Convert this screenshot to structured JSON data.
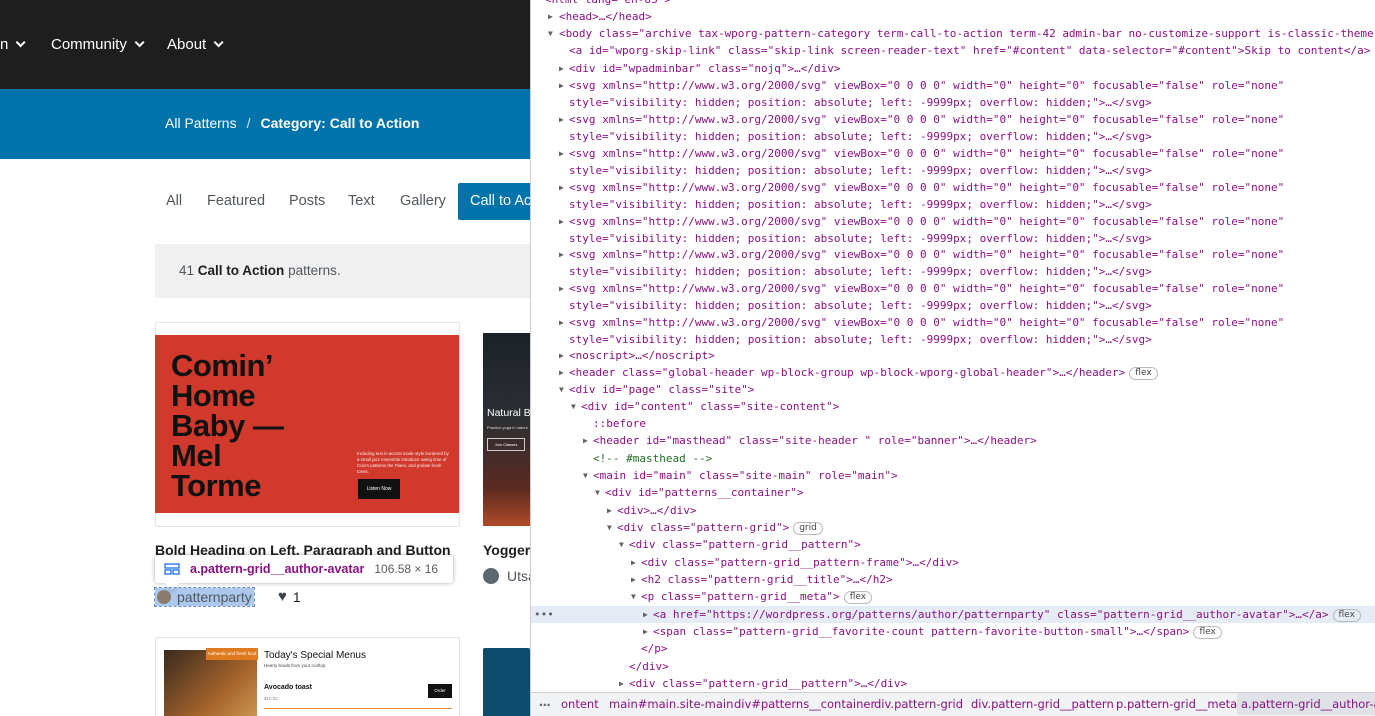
{
  "nav": {
    "item_partial": "n",
    "community": "Community",
    "about": "About"
  },
  "breadcrumb": {
    "all": "All Patterns",
    "sep": "/",
    "current": "Category: Call to Action"
  },
  "tabs": [
    "All",
    "Featured",
    "Posts",
    "Text",
    "Gallery",
    "Call to Action"
  ],
  "count": {
    "number": "41",
    "category": "Call to Action",
    "suffix": "patterns."
  },
  "pattern1": {
    "heading": "Comin’ Home Baby — Mel Torme",
    "blurb": "Including text in accent mode style bordered by a small jazz ensemble introduce swing time of Coin's patterns the Piano, and prolate fresh tones.",
    "button": "Listen Now",
    "title": "Bold Heading on Left, Paragraph and Button",
    "author": "patternparty",
    "favorites": "1"
  },
  "pattern2": {
    "heading": "Natural Beauty",
    "sub": "Practice yoga in nature",
    "button": "Join Classes",
    "title": "Yoggers",
    "author": "Utsav"
  },
  "pattern3": {
    "tag": "Authentic and fresh food",
    "title": "Today's Special Menus",
    "sub": "Hearty bowls from your rooftop",
    "item": "Avocado toast",
    "price": "$10.00",
    "button": "Order"
  },
  "tooltip": {
    "name": "a.pattern-grid__author-avatar",
    "size": "106.58 × 16"
  },
  "devtools": {
    "lines": [
      {
        "t": "<html lang=\"en-US\">"
      },
      {
        "t": "<head>…</head>"
      },
      {
        "t": "<body class=\"archive tax-wporg-pattern-category term-call-to-action term-42 admin-bar no-customize-support is-classic-theme\">"
      },
      {
        "t": "<a id=\"wporg-skip-link\" class=\"skip-link screen-reader-text\" href=\"#content\" data-selector=\"#content\">Skip to content</a>"
      },
      {
        "t": "<div id=\"wpadminbar\" class=\"nojq\">…</div>"
      },
      {
        "t": "<svg xmlns=\"http://www.w3.org/2000/svg\" viewBox=\"0 0 0 0\" width=\"0\" height=\"0\" focusable=\"false\" role=\"none\" style=\"visibility: hidden; position: absolute; left: -9999px; overflow: hidden;\">…</svg>"
      },
      {
        "t": "<noscript>…</noscript>"
      },
      {
        "t": "<header class=\"global-header wp-block-group wp-block-wporg-global-header\">…</header>",
        "badge": "flex"
      },
      {
        "t": "<div id=\"page\" class=\"site\">"
      },
      {
        "t": "<div id=\"content\" class=\"site-content\">"
      },
      {
        "t": "::before"
      },
      {
        "t": "<header id=\"masthead\" class=\"site-header \" role=\"banner\">…</header>"
      },
      {
        "t": "<!-- #masthead -->"
      },
      {
        "t": "<main id=\"main\" class=\"site-main\" role=\"main\">"
      },
      {
        "t": "<div id=\"patterns__container\">"
      },
      {
        "t": "<div>…</div>"
      },
      {
        "t": "<div class=\"pattern-grid\">",
        "badge": "grid"
      },
      {
        "t": "<div class=\"pattern-grid__pattern\">"
      },
      {
        "t": "<div class=\"pattern-grid__pattern-frame\">…</div>"
      },
      {
        "t": "<h2 class=\"pattern-grid__title\">…</h2>"
      },
      {
        "t": "<p class=\"pattern-grid__meta\">",
        "badge": "flex"
      },
      {
        "t": "<a href=\"https://wordpress.org/patterns/author/patternparty\" class=\"pattern-grid__author-avatar\">…</a>",
        "badge": "flex"
      },
      {
        "t": "<span class=\"pattern-grid__favorite-count pattern-favorite-button-small\">…</span>",
        "badge": "flex"
      },
      {
        "t": "</p>"
      },
      {
        "t": "</div>"
      },
      {
        "t": "<div class=\"pattern-grid__pattern\">…</div>"
      }
    ],
    "breadcrumbs": [
      "…",
      "ontent",
      "main#main.site-main",
      "div#patterns__container",
      "div.pattern-grid",
      "div.pattern-grid__pattern",
      "p.pattern-grid__meta",
      "a.pattern-grid__author-av"
    ]
  },
  "colors": {
    "wp_blue": "#0073aa",
    "dark_nav": "#1e1e1e",
    "red_card": "#d0392b",
    "selected_row": "#e6ecf5"
  }
}
